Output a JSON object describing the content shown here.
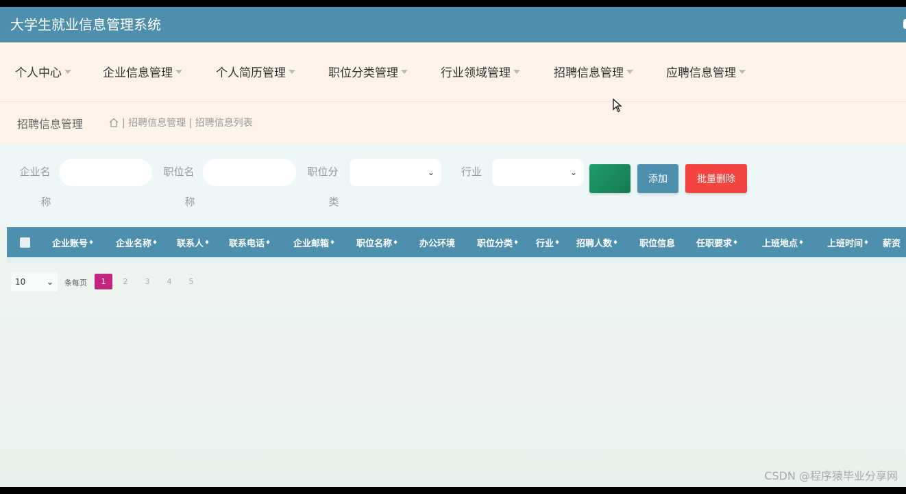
{
  "app": {
    "title": "大学生就业信息管理系统"
  },
  "menu": [
    {
      "label": "个人中心"
    },
    {
      "label": "企业信息管理"
    },
    {
      "label": "个人简历管理"
    },
    {
      "label": "职位分类管理"
    },
    {
      "label": "行业领域管理"
    },
    {
      "label": "招聘信息管理"
    },
    {
      "label": "应聘信息管理"
    }
  ],
  "breadcrumb": {
    "title": "招聘信息管理",
    "path": "| 招聘信息管理 | 招聘信息列表"
  },
  "search": {
    "company_label_1": "企业名",
    "company_label_2": "称",
    "position_label_1": "职位名",
    "position_label_2": "称",
    "category_label_1": "职位分",
    "category_label_2": "类",
    "industry_label": "行业",
    "add_label": "添加",
    "batch_delete_label": "批量删除"
  },
  "table": {
    "columns": [
      "企业账号",
      "企业名称",
      "联系人",
      "联系电话",
      "企业邮箱",
      "职位名称",
      "办公环境",
      "职位分类",
      "行业",
      "招聘人数",
      "职位信息",
      "任职要求",
      "上班地点",
      "上班时间",
      "薪资"
    ]
  },
  "pager": {
    "page_size": "10",
    "label": "条每页",
    "pages": [
      "1",
      "2",
      "3",
      "4",
      "5"
    ]
  },
  "watermark": "CSDN @程序猿毕业分享网",
  "colors": {
    "header_bg": "#4d8fad",
    "nav_bg": "#fdf3e7",
    "search_btn": "#1b8a63",
    "add_btn": "#4d8fad",
    "delete_btn": "#f4443f",
    "active_page": "#c2267e"
  }
}
